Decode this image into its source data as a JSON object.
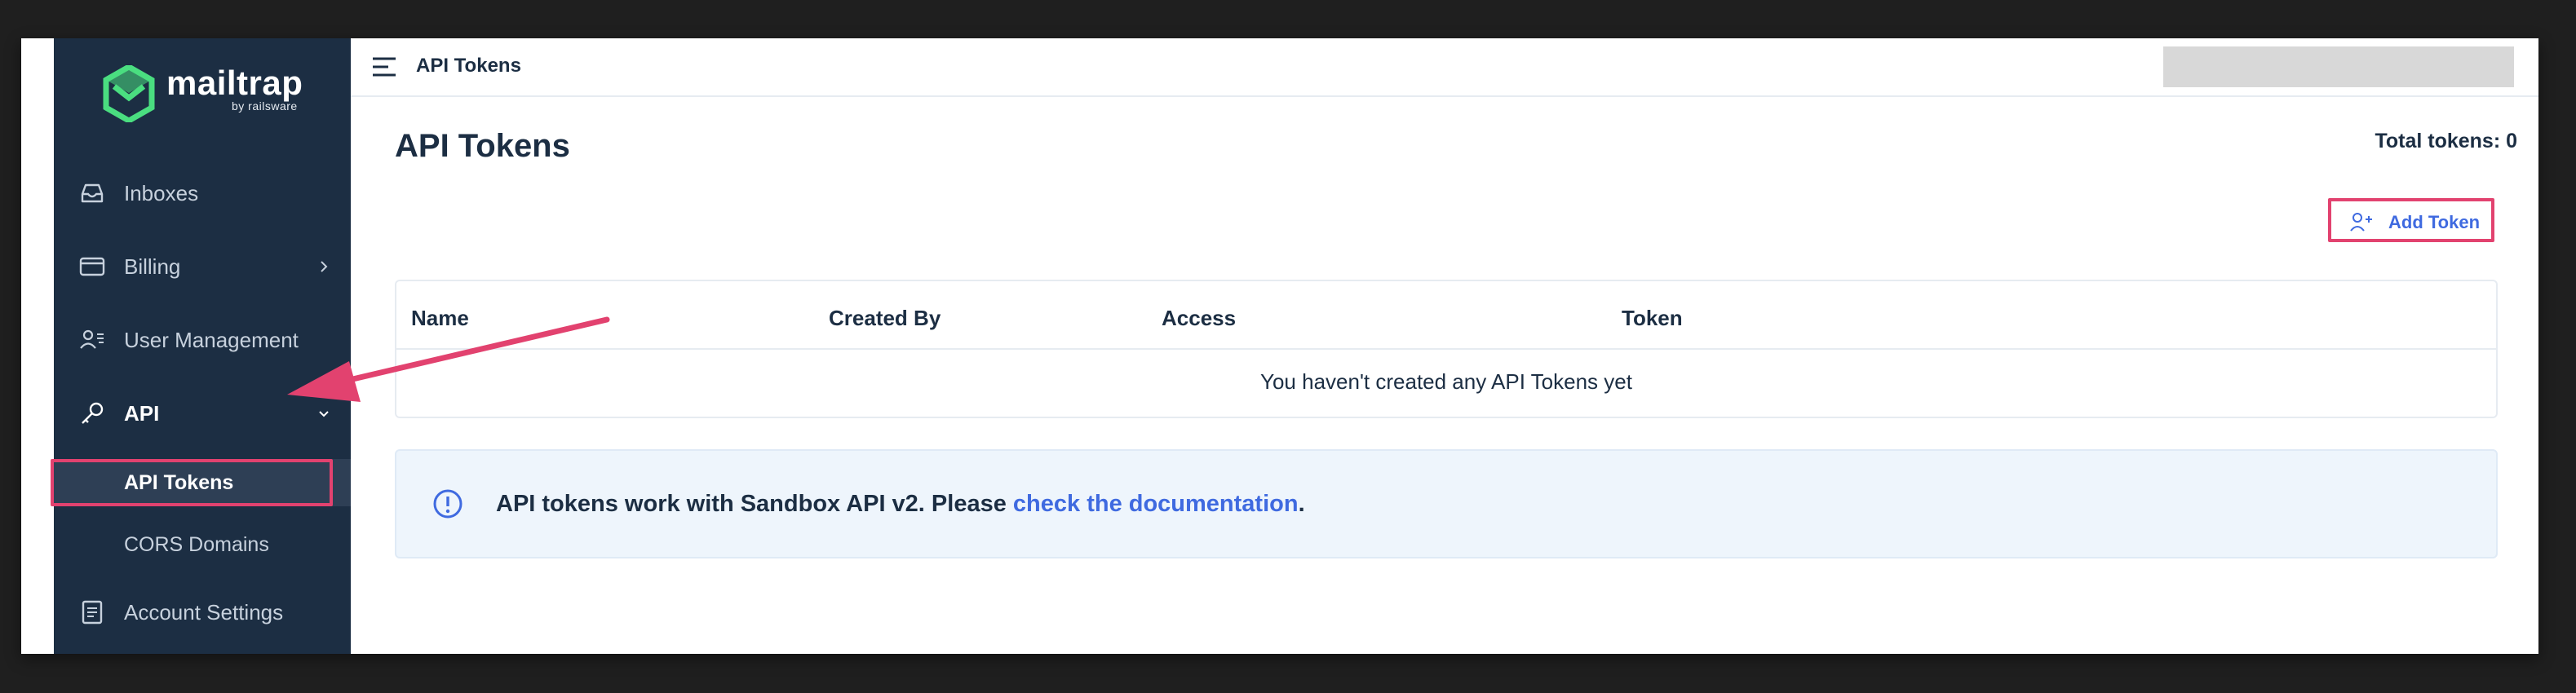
{
  "logo": {
    "name": "mailtrap",
    "sub": "by railsware",
    "brand_color": "#4ade80"
  },
  "sidebar": {
    "items": [
      {
        "label": "Inboxes",
        "icon": "inbox-icon"
      },
      {
        "label": "Billing",
        "icon": "credit-card-icon",
        "chevron": "chevron-right-icon"
      },
      {
        "label": "User Management",
        "icon": "users-icon"
      },
      {
        "label": "API",
        "icon": "key-icon",
        "chevron": "chevron-down-icon"
      },
      {
        "label": "Account Settings",
        "icon": "document-icon"
      }
    ],
    "api_sub": [
      {
        "label": "API Tokens",
        "selected": true
      },
      {
        "label": "CORS Domains",
        "selected": false
      }
    ]
  },
  "topbar": {
    "title": "API Tokens",
    "menu_icon": "hamburger-icon"
  },
  "main": {
    "title": "API Tokens",
    "total_tokens": "Total tokens: 0",
    "add_button": {
      "label": "Add Token",
      "icon": "add-user-icon"
    },
    "table": {
      "columns": [
        "Name",
        "Created By",
        "Access",
        "Token"
      ],
      "empty_message": "You haven't created any API Tokens yet"
    },
    "info": {
      "icon": "info-circle-icon",
      "text": "API tokens work with Sandbox API v2. Please ",
      "link": "check the documentation",
      "suffix": "."
    }
  },
  "colors": {
    "sidebar_bg": "#1c2e43",
    "accent": "#3f6ae0",
    "highlight": "#e2426f"
  }
}
